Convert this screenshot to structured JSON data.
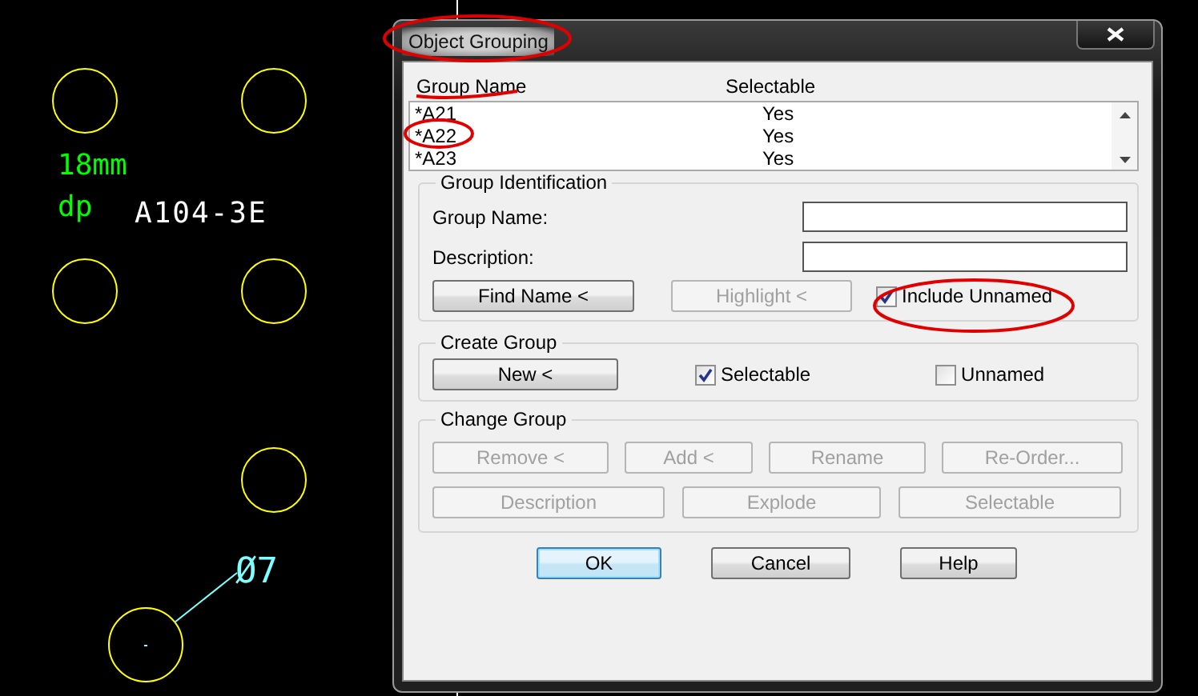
{
  "drawing": {
    "labels": [
      {
        "text": "18mm",
        "color": "#00ff00"
      },
      {
        "text": "dp",
        "color": "#00ff00"
      },
      {
        "text": "A104-3E",
        "color": "#ffffff"
      },
      {
        "text": "Ø7",
        "color": "#7fffff"
      }
    ]
  },
  "dialog": {
    "title": "Object Grouping",
    "list": {
      "columns": [
        "Group Name",
        "Selectable"
      ],
      "rows": [
        {
          "name": "*A21",
          "selectable": "Yes"
        },
        {
          "name": "*A22",
          "selectable": "Yes"
        },
        {
          "name": "*A23",
          "selectable": "Yes"
        }
      ]
    },
    "group_identification": {
      "title": "Group Identification",
      "fields": [
        {
          "label": "Group Name:"
        },
        {
          "label": "Description:"
        }
      ],
      "buttons": [
        {
          "label": "Find Name <",
          "disabled": false
        },
        {
          "label": "Highlight <",
          "disabled": true
        }
      ],
      "checkbox": {
        "label": "Include Unnamed",
        "checked": true
      }
    },
    "create_group": {
      "title": "Create Group",
      "button": {
        "label": "New <",
        "disabled": false
      },
      "checkboxes": [
        {
          "label": "Selectable",
          "checked": true
        },
        {
          "label": "Unnamed",
          "checked": false
        }
      ]
    },
    "change_group": {
      "title": "Change Group",
      "rows": [
        {
          "buttons": [
            {
              "label": "Remove <",
              "disabled": true
            },
            {
              "label": "Add <",
              "disabled": true
            },
            {
              "label": "Rename",
              "disabled": true
            },
            {
              "label": "Re-Order...",
              "disabled": true
            }
          ]
        },
        {
          "buttons": [
            {
              "label": "Description",
              "disabled": true
            },
            {
              "label": "Explode",
              "disabled": true
            },
            {
              "label": "Selectable",
              "disabled": true
            }
          ]
        }
      ]
    },
    "buttons": [
      {
        "label": "OK",
        "default": true
      },
      {
        "label": "Cancel",
        "default": false
      },
      {
        "label": "Help",
        "default": false
      }
    ]
  }
}
